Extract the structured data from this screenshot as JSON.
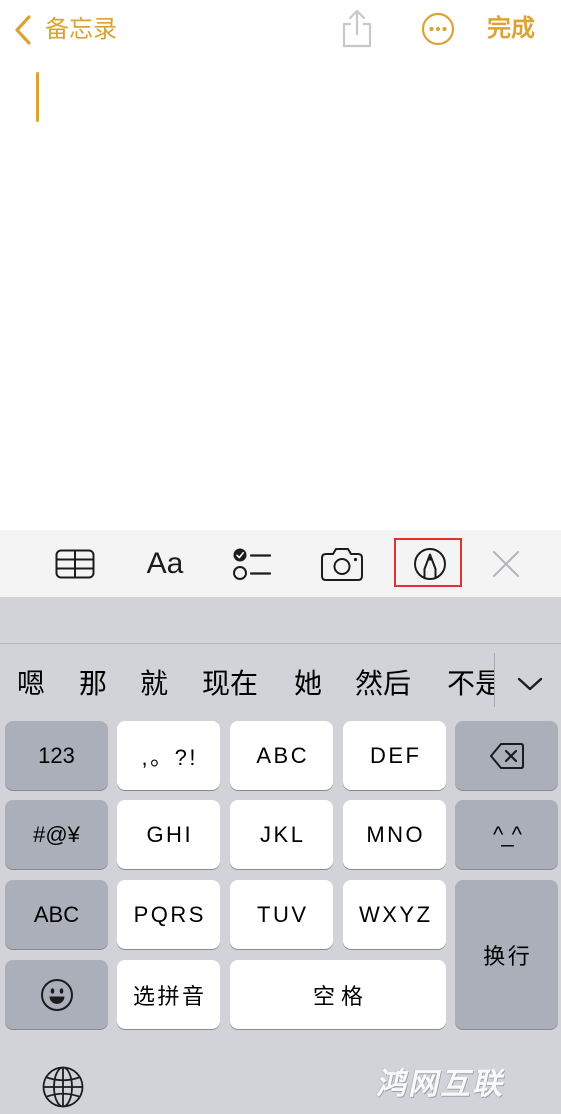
{
  "nav": {
    "back_icon": "chevron-left-icon",
    "back_label": "备忘录",
    "share_icon": "share-icon",
    "more_icon": "ellipsis-circle-icon",
    "done_label": "完成"
  },
  "note": {
    "cursor": "text-cursor"
  },
  "toolbar": {
    "icons": [
      "table-icon",
      "text-format-icon",
      "checklist-icon",
      "camera-icon",
      "markup-icon",
      "close-icon"
    ],
    "format_label": "Aa",
    "highlighted": "markup-icon"
  },
  "keyboard": {
    "candidates": [
      "嗯",
      "那",
      "就",
      "现在",
      "她",
      "然后",
      "不是"
    ],
    "expand_icon": "chevron-down-icon",
    "rows": [
      {
        "keys": [
          "123",
          ",。?!",
          "ABC",
          "DEF"
        ],
        "end_icon": "delete-left-icon"
      },
      {
        "keys": [
          "#@¥",
          "GHI",
          "JKL",
          "MNO",
          "^_^"
        ]
      },
      {
        "keys": [
          "ABC",
          "PQRS",
          "TUV",
          "WXYZ",
          "换行"
        ]
      },
      {
        "start_icon": "emoji-icon",
        "keys": [
          "选拼音",
          "空格"
        ]
      }
    ],
    "globe_icon": "globe-icon"
  },
  "watermark": "鸿网互联",
  "colors": {
    "accent": "#D9A433",
    "disabled_icon": "#C7C7CC",
    "toolbar_background": "#F4F4F5",
    "keyboard_background": "#D1D3D9",
    "function_key": "#ABAFB9",
    "character_key": "#FFFFFF",
    "highlight_box": "#E0332F"
  }
}
